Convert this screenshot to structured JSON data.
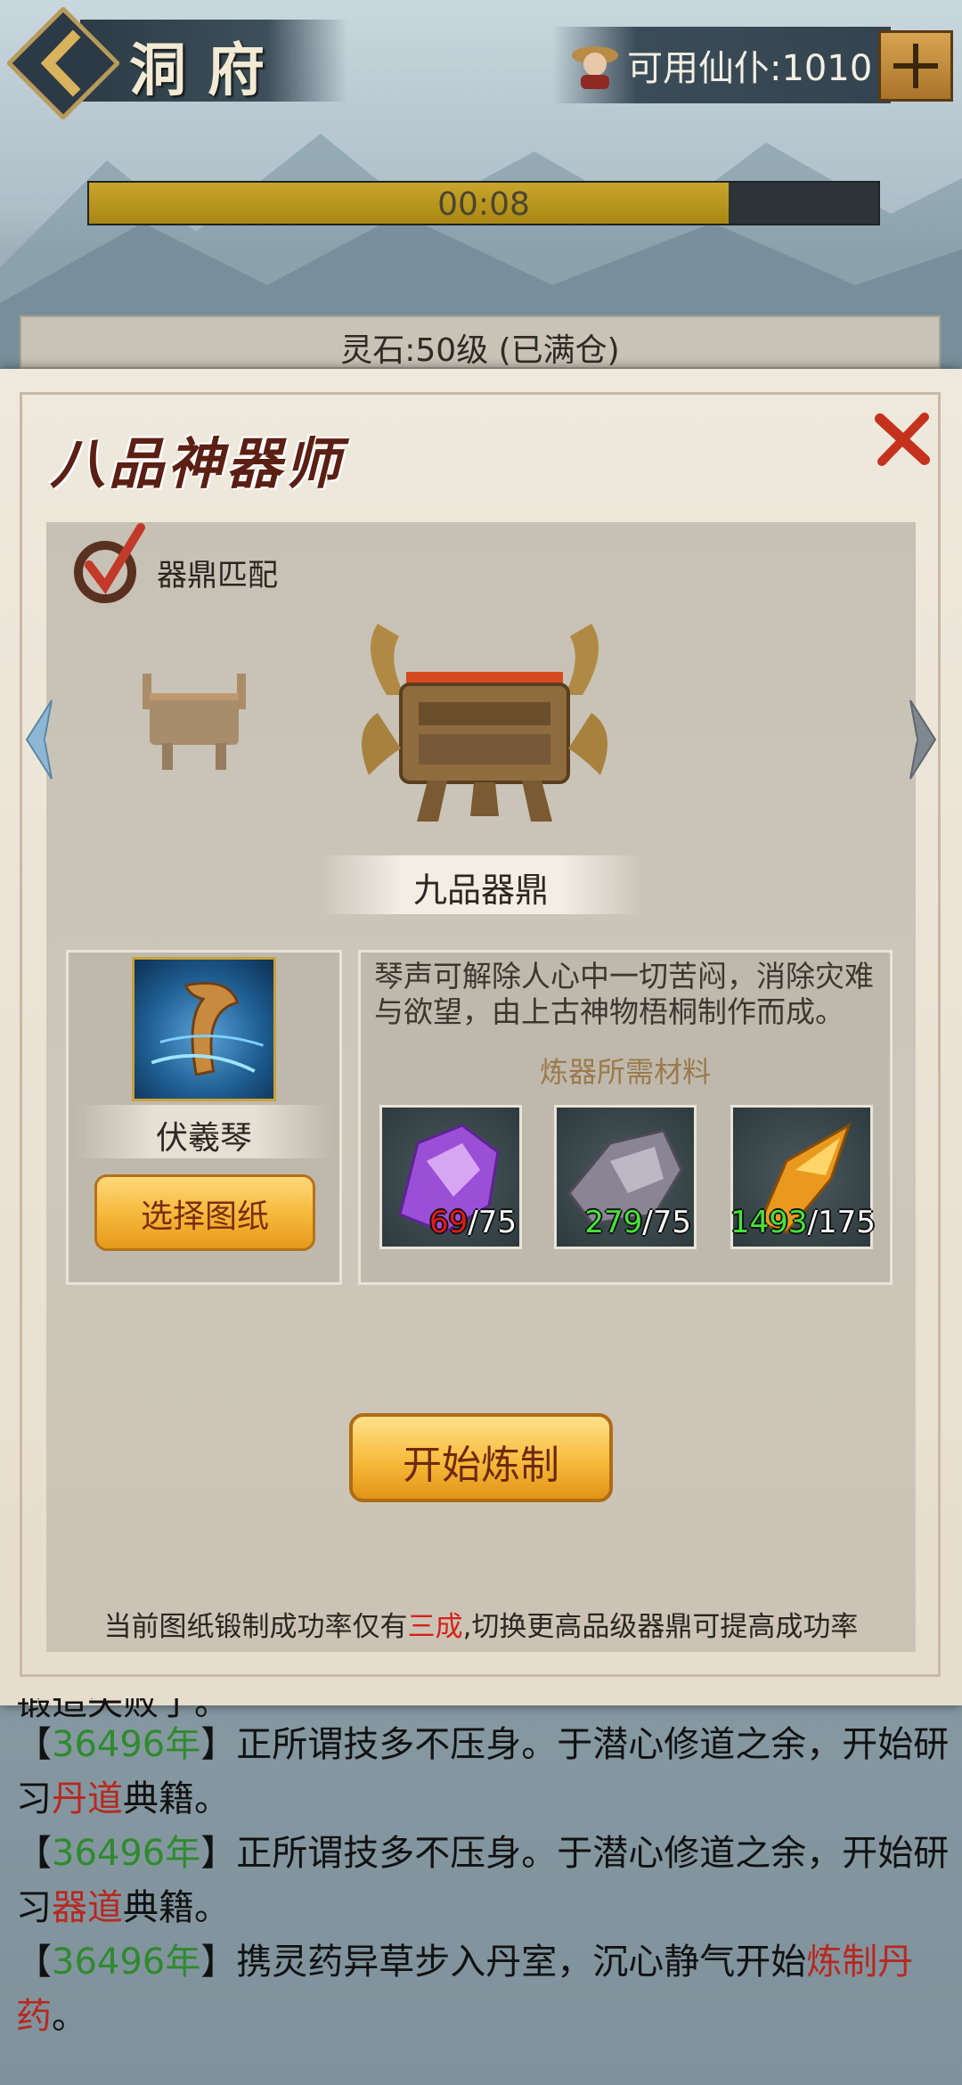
{
  "header": {
    "title": "洞府",
    "resource_label": "可用仙仆:1010"
  },
  "timer": {
    "text": "00:08",
    "progress": 0.81
  },
  "status_bar": {
    "text": "灵石:50级 (已满仓)"
  },
  "panel": {
    "title": "八品神器师",
    "match_label": "器鼎匹配",
    "cauldron_name": "九品器鼎",
    "blueprint": {
      "name": "伏羲琴",
      "select_label": "选择图纸",
      "description": "琴声可解除人心中一切苦闷，消除灾难与欲望，由上古神物梧桐制作而成。"
    },
    "materials_title": "炼器所需材料",
    "materials": [
      {
        "icon": "purple-crystal-icon",
        "have": "69",
        "need": "/75",
        "sufficient": false
      },
      {
        "icon": "grey-ore-icon",
        "have": "279",
        "need": "/75",
        "sufficient": true
      },
      {
        "icon": "amber-crystal-icon",
        "have": "1493",
        "need": "/175",
        "sufficient": true
      }
    ],
    "start_label": "开始炼制",
    "tip_prefix": "当前图纸锻制成功率仅有",
    "tip_highlight": "三成",
    "tip_suffix": ",切换更高品级器鼎可提高成功率"
  },
  "log": {
    "partial_line": "锻造失败了。",
    "entries": [
      {
        "lb": "【",
        "year": "36496年",
        "rb": "】",
        "pre": "正所谓技多不压身。于潜心修道之余，开始研习",
        "hl": "丹道",
        "post": "典籍。"
      },
      {
        "lb": "【",
        "year": "36496年",
        "rb": "】",
        "pre": "正所谓技多不压身。于潜心修道之余，开始研习",
        "hl": "器道",
        "post": "典籍。"
      },
      {
        "lb": "【",
        "year": "36496年",
        "rb": "】",
        "pre": "携灵药异草步入丹室，沉心静气开始",
        "hl": "炼制丹药",
        "post": "。"
      }
    ]
  },
  "colors": {
    "timer_fill": "#c9a52a",
    "insufficient": "#e01a1a",
    "sufficient": "#47e23a",
    "year": "#2f8a2f",
    "highlight": "#b7281f"
  }
}
